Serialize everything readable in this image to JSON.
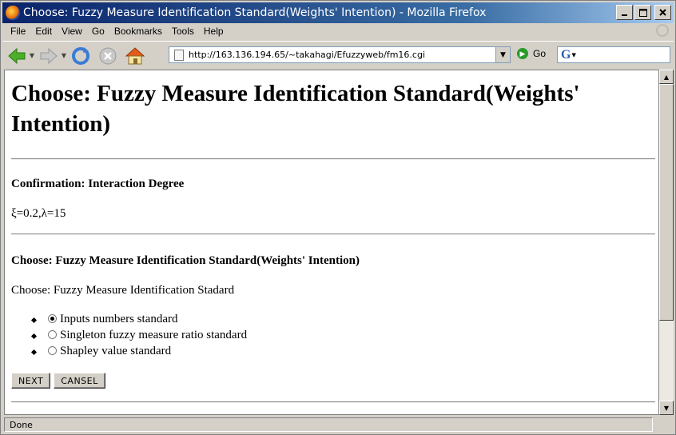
{
  "window": {
    "title": "Choose: Fuzzy Measure Identification Standard(Weights' Intention) - Mozilla Firefox",
    "minimize": "_",
    "maximize": "□",
    "close": "X"
  },
  "menu": [
    "File",
    "Edit",
    "View",
    "Go",
    "Bookmarks",
    "Tools",
    "Help"
  ],
  "toolbar": {
    "url": "http://163.136.194.65/~takahagi/Efuzzyweb/fm16.cgi",
    "go_label": "Go",
    "search_engine": "G"
  },
  "page": {
    "heading": "Choose: Fuzzy Measure Identification Standard(Weights' Intention)",
    "confirm_title": "Confirmation: Interaction Degree",
    "confirm_value": "ξ=0.2,λ=15",
    "choose_title": "Choose: Fuzzy Measure Identification Standard(Weights' Intention)",
    "choose_prompt": "Choose: Fuzzy Measure Identification Stadard",
    "options": [
      {
        "label": "Inputs numbers standard",
        "selected": true
      },
      {
        "label": "Singleton fuzzy measure ratio standard",
        "selected": false
      },
      {
        "label": "Shapley value standard",
        "selected": false
      }
    ],
    "next_button": "NEXT",
    "cancel_button": "CANSEL"
  },
  "status": "Done"
}
